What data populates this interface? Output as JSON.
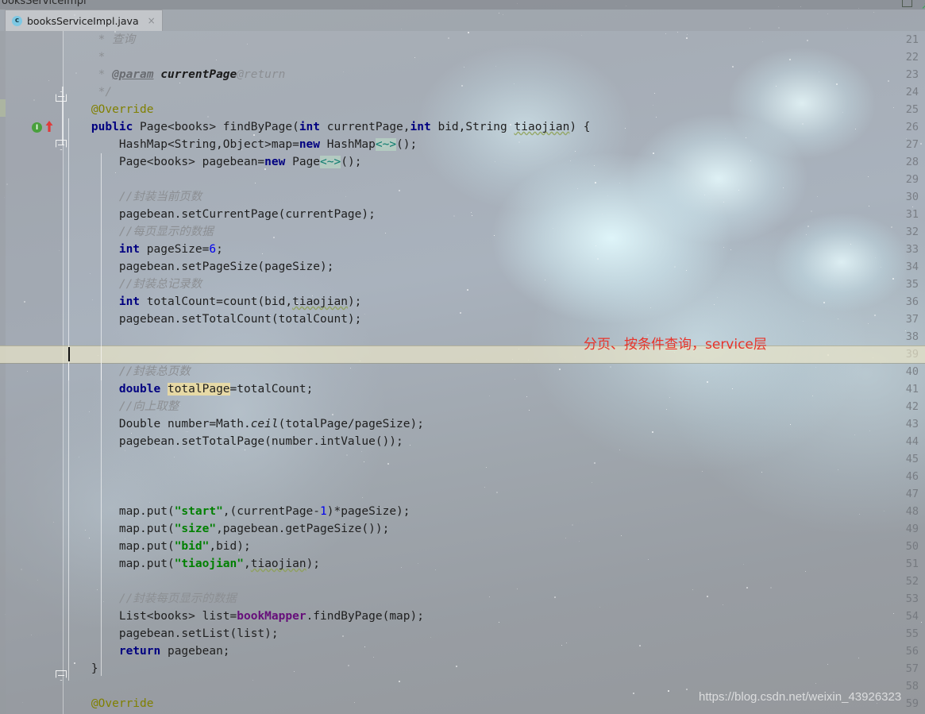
{
  "window": {
    "cut_title": "ooksServiceImpl",
    "buttons": [
      {
        "name": "restore-window-button",
        "glyph": "box"
      },
      {
        "name": "close-window-button",
        "glyph": "arrow"
      }
    ]
  },
  "tab": {
    "icon": "c",
    "label": "booksServiceImpl.java",
    "close": "×"
  },
  "annotation": {
    "text": "分页、按条件查询，service层",
    "color": "#e8342a"
  },
  "watermark": {
    "text": "https://blog.csdn.net/weixin_43926323"
  },
  "editor": {
    "current_line": 39,
    "first_line": 21,
    "last_line": 59,
    "gutter_markers": {
      "line_26_impl": "I",
      "line_26_override_arrow": "↑"
    },
    "line_numbers": [
      21,
      22,
      23,
      24,
      25,
      26,
      27,
      28,
      29,
      30,
      31,
      32,
      33,
      34,
      35,
      36,
      37,
      38,
      39,
      40,
      41,
      42,
      43,
      44,
      45,
      46,
      47,
      48,
      49,
      50,
      51,
      52,
      53,
      54,
      55,
      56,
      57,
      58,
      59
    ],
    "lines": [
      {
        "n": 21,
        "text": "     * 查询"
      },
      {
        "n": 22,
        "text": "     *"
      },
      {
        "n": 23,
        "text": "     * @param currentPage@return"
      },
      {
        "n": 24,
        "text": "     */"
      },
      {
        "n": 25,
        "text": "    @Override"
      },
      {
        "n": 26,
        "text": "    public Page<books> findByPage(int currentPage,int bid,String tiaojian) {"
      },
      {
        "n": 27,
        "text": "        HashMap<String,Object>map=new HashMap<~>();"
      },
      {
        "n": 28,
        "text": "        Page<books> pagebean=new Page<~>();"
      },
      {
        "n": 29,
        "text": ""
      },
      {
        "n": 30,
        "text": "        //封装当前页数"
      },
      {
        "n": 31,
        "text": "        pagebean.setCurrentPage(currentPage);"
      },
      {
        "n": 32,
        "text": "        //每页显示的数据"
      },
      {
        "n": 33,
        "text": "        int pageSize=6;"
      },
      {
        "n": 34,
        "text": "        pagebean.setPageSize(pageSize);"
      },
      {
        "n": 35,
        "text": "        //封装总记录数"
      },
      {
        "n": 36,
        "text": "        int totalCount=count(bid,tiaojian);"
      },
      {
        "n": 37,
        "text": "        pagebean.setTotalCount(totalCount);"
      },
      {
        "n": 38,
        "text": ""
      },
      {
        "n": 39,
        "text": ""
      },
      {
        "n": 40,
        "text": "        //封装总页数"
      },
      {
        "n": 41,
        "text": "        double totalPage=totalCount;"
      },
      {
        "n": 42,
        "text": "        //向上取整"
      },
      {
        "n": 43,
        "text": "        Double number=Math.ceil(totalPage/pageSize);"
      },
      {
        "n": 44,
        "text": "        pagebean.setTotalPage(number.intValue());"
      },
      {
        "n": 45,
        "text": ""
      },
      {
        "n": 46,
        "text": ""
      },
      {
        "n": 47,
        "text": ""
      },
      {
        "n": 48,
        "text": "        map.put(\"start\",(currentPage-1)*pageSize);"
      },
      {
        "n": 49,
        "text": "        map.put(\"size\",pagebean.getPageSize());"
      },
      {
        "n": 50,
        "text": "        map.put(\"bid\",bid);"
      },
      {
        "n": 51,
        "text": "        map.put(\"tiaojian\",tiaojian);"
      },
      {
        "n": 52,
        "text": ""
      },
      {
        "n": 53,
        "text": "        //封装每页显示的数据"
      },
      {
        "n": 54,
        "text": "        List<books> list=bookMapper.findByPage(map);"
      },
      {
        "n": 55,
        "text": "        pagebean.setList(list);"
      },
      {
        "n": 56,
        "text": "        return pagebean;"
      },
      {
        "n": 57,
        "text": "    }"
      },
      {
        "n": 58,
        "text": ""
      },
      {
        "n": 59,
        "text": "    @Override"
      }
    ]
  },
  "colors": {
    "keyword": "#000080",
    "comment": "#8c8f93",
    "annotation_token": "#808000",
    "string": "#008000",
    "number": "#0000ee",
    "field": "#660e7a",
    "current_line_bg": "#e8e3c8",
    "accent_red": "#e8342a"
  }
}
